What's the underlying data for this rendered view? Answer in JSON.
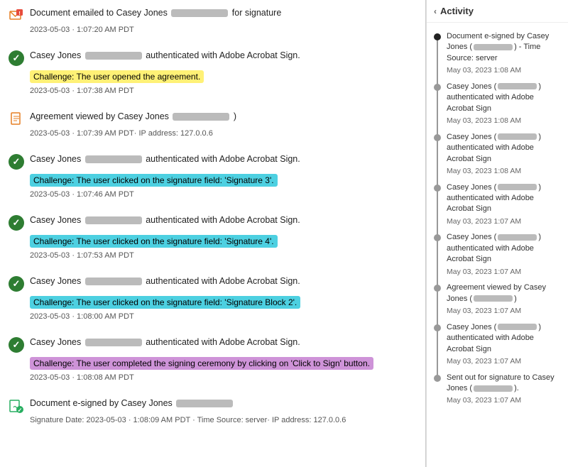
{
  "activity_panel": {
    "title": "Activity",
    "items": [
      {
        "id": 1,
        "dot": "dark",
        "text_parts": [
          "Document e-signed by Casey",
          "Jones (",
          "blurred",
          ") -",
          "Time Source: server"
        ],
        "date": "May 03, 2023 1:08 AM"
      },
      {
        "id": 2,
        "dot": "gray",
        "text_parts": [
          "Casey Jones",
          "(",
          "blurred",
          ")",
          "authenticated with Adobe",
          "Acrobat Sign"
        ],
        "date": "May 03, 2023 1:08 AM"
      },
      {
        "id": 3,
        "dot": "gray",
        "text_parts": [
          "Casey Jones",
          "(",
          "blurred",
          ")",
          "authenticated with Adobe",
          "Acrobat Sign"
        ],
        "date": "May 03, 2023 1:08 AM"
      },
      {
        "id": 4,
        "dot": "gray",
        "text_parts": [
          "Casey Jones",
          "(",
          "blurred",
          ")",
          "authenticated with Adobe",
          "Acrobat Sign"
        ],
        "date": "May 03, 2023 1:07 AM"
      },
      {
        "id": 5,
        "dot": "gray",
        "text_parts": [
          "Casey Jones",
          "(",
          "blurred",
          ")",
          "authenticated with Adobe",
          "Acrobat Sign"
        ],
        "date": "May 03, 2023 1:07 AM"
      },
      {
        "id": 6,
        "dot": "gray",
        "text_parts": [
          "Agreement viewed by Casey",
          "Jones (",
          "blurred",
          ")"
        ],
        "date": "May 03, 2023 1:07 AM"
      },
      {
        "id": 7,
        "dot": "gray",
        "text_parts": [
          "Casey Jones",
          "(",
          "blurred",
          ")",
          "authenticated with Adobe",
          "Acrobat Sign"
        ],
        "date": "May 03, 2023 1:07 AM"
      },
      {
        "id": 8,
        "dot": "gray",
        "text_parts": [
          "Sent out for signature to Casey",
          "Jones (",
          "blurred",
          ")."
        ],
        "date": "May 03, 2023 1:07 AM"
      }
    ]
  },
  "left_events": [
    {
      "id": 1,
      "icon_type": "email",
      "text": "Document emailed to Casey Jones",
      "text_suffix": "for signature",
      "timestamp": "2023-05-03 · 1:07:20 AM PDT"
    },
    {
      "id": 2,
      "icon_type": "check",
      "text": "Casey Jones",
      "text_suffix": "authenticated with Adobe Acrobat Sign.",
      "challenge_type": "yellow",
      "challenge_text": "Challenge: The user opened the agreement.",
      "timestamp": "2023-05-03 · 1:07:38 AM PDT"
    },
    {
      "id": 3,
      "icon_type": "doc",
      "text": "Agreement viewed by Casey Jones",
      "text_suffix": ")",
      "timestamp": "2023-05-03 · 1:07:39 AM PDT· IP address: 127.0.0.6"
    },
    {
      "id": 4,
      "icon_type": "check",
      "text": "Casey Jones",
      "text_suffix": "authenticated with Adobe Acrobat Sign.",
      "challenge_type": "cyan",
      "challenge_text": "Challenge: The user clicked on the signature field: 'Signature 3'.",
      "timestamp": "2023-05-03 · 1:07:46 AM PDT"
    },
    {
      "id": 5,
      "icon_type": "check",
      "text": "Casey Jones",
      "text_suffix": "authenticated with Adobe Acrobat Sign.",
      "challenge_type": "cyan",
      "challenge_text": "Challenge: The user clicked on the signature field: 'Signature 4'.",
      "timestamp": "2023-05-03 · 1:07:53 AM PDT"
    },
    {
      "id": 6,
      "icon_type": "check",
      "text": "Casey Jones",
      "text_suffix": "authenticated with Adobe Acrobat Sign.",
      "challenge_type": "cyan",
      "challenge_text": "Challenge: The user clicked on the signature field: 'Signature Block 2'.",
      "timestamp": "2023-05-03 · 1:08:00 AM PDT"
    },
    {
      "id": 7,
      "icon_type": "check",
      "text": "Casey Jones",
      "text_suffix": "authenticated with Adobe Acrobat Sign.",
      "challenge_type": "purple",
      "challenge_text": "Challenge: The user completed the signing ceremony by clicking on 'Click to Sign' button.",
      "timestamp": "2023-05-03 · 1:08:08 AM PDT"
    },
    {
      "id": 8,
      "icon_type": "esign",
      "text": "Document e-signed by Casey Jones",
      "text_suffix": "",
      "timestamp": "Signature Date: 2023-05-03 · 1:08:09 AM PDT · Time Source: server· IP address: 127.0.0.6"
    }
  ]
}
